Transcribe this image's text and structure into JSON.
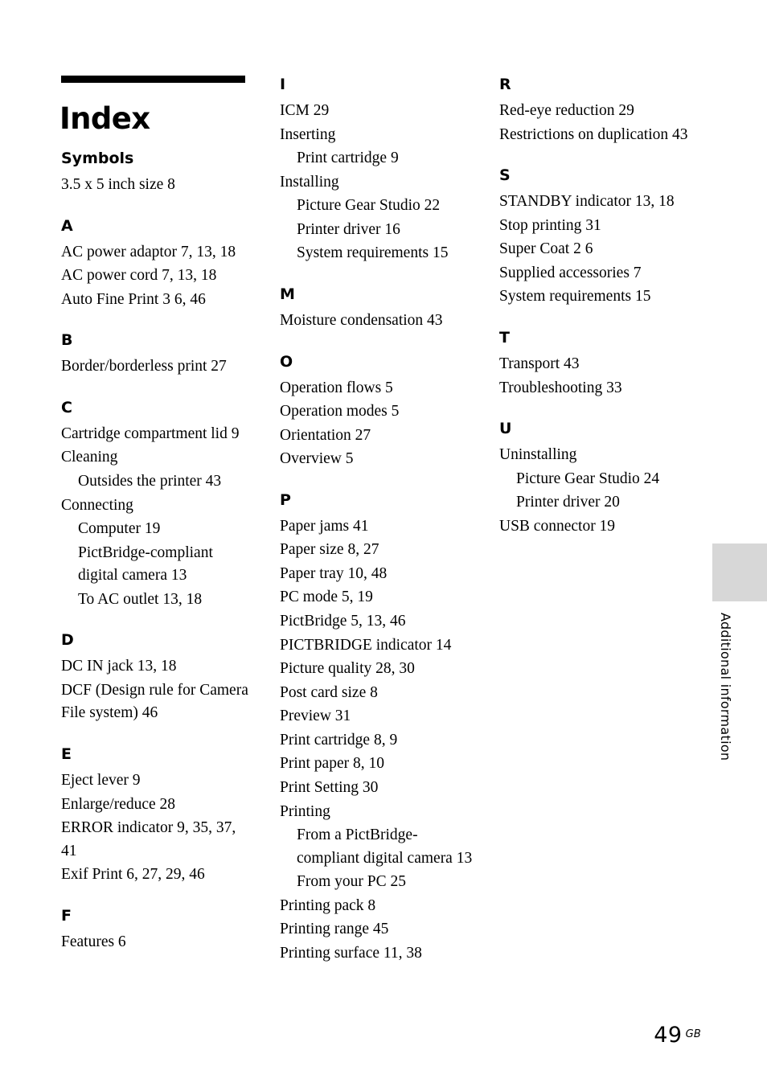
{
  "document": {
    "title": "Index",
    "edge_tab_label": "Additional information",
    "folio": "49",
    "folio_suffix": "GB"
  },
  "columns": [
    {
      "id": "column-left",
      "groups": [
        {
          "letter": "Symbols",
          "entries": [
            {
              "text": "3.5 x 5 inch size  8",
              "sub": false
            }
          ]
        },
        {
          "letter": "A",
          "entries": [
            {
              "text": "AC power adaptor 7,  13,  18",
              "sub": false
            },
            {
              "text": "AC power cord  7,  13,  18",
              "sub": false
            },
            {
              "text": "Auto Fine Print 3  6,  46",
              "sub": false
            }
          ]
        },
        {
          "letter": "B",
          "entries": [
            {
              "text": "Border/borderless print 27",
              "sub": false
            }
          ]
        },
        {
          "letter": "C",
          "entries": [
            {
              "text": "Cartridge compartment lid  9",
              "sub": false
            },
            {
              "text": "Cleaning",
              "sub": false
            },
            {
              "text": "Outsides the printer  43",
              "sub": true
            },
            {
              "text": "Connecting",
              "sub": false
            },
            {
              "text": "Computer  19",
              "sub": true
            },
            {
              "text": "PictBridge-compliant digital camera  13",
              "sub": true
            },
            {
              "text": "To AC outlet  13,  18",
              "sub": true
            }
          ]
        },
        {
          "letter": "D",
          "entries": [
            {
              "text": "DC IN jack  13,  18",
              "sub": false
            },
            {
              "text": "DCF (Design rule for Camera File system)  46",
              "sub": false
            }
          ]
        },
        {
          "letter": "E",
          "entries": [
            {
              "text": "Eject lever  9",
              "sub": false
            },
            {
              "text": "Enlarge/reduce  28",
              "sub": false
            },
            {
              "text": "ERROR indicator 9,  35,  37,  41",
              "sub": false
            },
            {
              "text": "Exif Print  6,  27,  29,  46",
              "sub": false
            }
          ]
        },
        {
          "letter": "F",
          "entries": [
            {
              "text": "Features  6",
              "sub": false
            }
          ]
        }
      ]
    },
    {
      "id": "column-middle",
      "groups": [
        {
          "letter": "I",
          "entries": [
            {
              "text": "ICM  29",
              "sub": false
            },
            {
              "text": "Inserting",
              "sub": false
            },
            {
              "text": "Print cartridge  9",
              "sub": true
            },
            {
              "text": "Installing",
              "sub": false
            },
            {
              "text": "Picture Gear Studio  22",
              "sub": true
            },
            {
              "text": "Printer driver  16",
              "sub": true
            },
            {
              "text": "System requirements 15",
              "sub": true
            }
          ]
        },
        {
          "letter": "M",
          "entries": [
            {
              "text": "Moisture condensation 43",
              "sub": false
            }
          ]
        },
        {
          "letter": "O",
          "entries": [
            {
              "text": "Operation flows  5",
              "sub": false
            },
            {
              "text": "Operation modes  5",
              "sub": false
            },
            {
              "text": "Orientation  27",
              "sub": false
            },
            {
              "text": "Overview  5",
              "sub": false
            }
          ]
        },
        {
          "letter": "P",
          "entries": [
            {
              "text": "Paper jams  41",
              "sub": false
            },
            {
              "text": "Paper size  8,  27",
              "sub": false
            },
            {
              "text": "Paper tray  10,  48",
              "sub": false
            },
            {
              "text": "PC mode  5,  19",
              "sub": false
            },
            {
              "text": "PictBridge  5,  13,  46",
              "sub": false
            },
            {
              "text": "PICTBRIDGE indicator 14",
              "sub": false
            },
            {
              "text": "Picture quality  28,  30",
              "sub": false
            },
            {
              "text": "Post card size  8",
              "sub": false
            },
            {
              "text": "Preview  31",
              "sub": false
            },
            {
              "text": "Print cartridge  8,  9",
              "sub": false
            },
            {
              "text": "Print paper  8,  10",
              "sub": false
            },
            {
              "text": "Print Setting  30",
              "sub": false
            },
            {
              "text": "Printing",
              "sub": false
            },
            {
              "text": "From a PictBridge-compliant digital camera  13",
              "sub": true
            },
            {
              "text": "From your PC  25",
              "sub": true
            },
            {
              "text": "Printing pack  8",
              "sub": false
            },
            {
              "text": "Printing range  45",
              "sub": false
            },
            {
              "text": "Printing surface  11,  38",
              "sub": false
            }
          ]
        }
      ]
    },
    {
      "id": "column-right",
      "groups": [
        {
          "letter": "R",
          "entries": [
            {
              "text": "Red-eye reduction  29",
              "sub": false
            },
            {
              "text": "Restrictions on duplication  43",
              "sub": false
            }
          ]
        },
        {
          "letter": "S",
          "entries": [
            {
              "text": "STANDBY indicator 13,  18",
              "sub": false
            },
            {
              "text": "Stop printing  31",
              "sub": false
            },
            {
              "text": "Super Coat 2  6",
              "sub": false
            },
            {
              "text": "Supplied accessories  7",
              "sub": false
            },
            {
              "text": "System requirements  15",
              "sub": false
            }
          ]
        },
        {
          "letter": "T",
          "entries": [
            {
              "text": "Transport  43",
              "sub": false
            },
            {
              "text": "Troubleshooting  33",
              "sub": false
            }
          ]
        },
        {
          "letter": "U",
          "entries": [
            {
              "text": "Uninstalling",
              "sub": false
            },
            {
              "text": "Picture Gear Studio  24",
              "sub": true
            },
            {
              "text": "Printer driver  20",
              "sub": true
            },
            {
              "text": "USB connector  19",
              "sub": false
            }
          ]
        }
      ]
    }
  ]
}
